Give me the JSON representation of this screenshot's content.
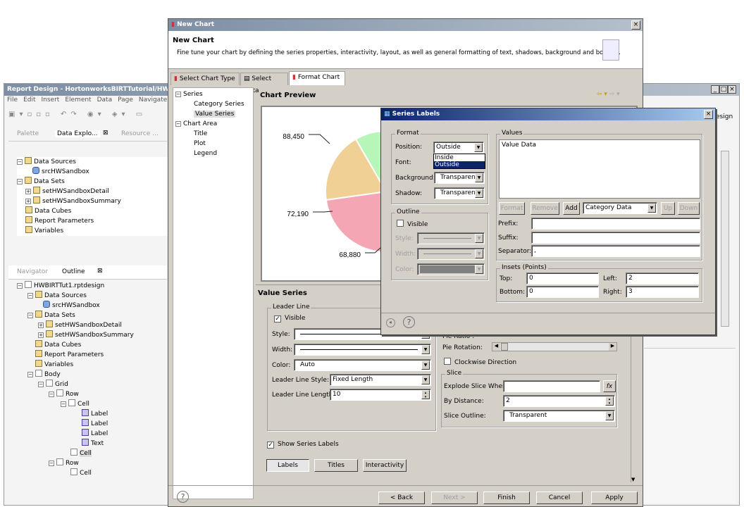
{
  "report_window": {
    "title": "Report Design - HortonworksBIRTTutorial/HW",
    "menu": [
      "File",
      "Edit",
      "Insert",
      "Element",
      "Data",
      "Page",
      "Navigate"
    ],
    "explorer_tabs": [
      "Palette",
      "Data Explo...",
      "Resource ..."
    ],
    "data_tree": [
      "Data Sources",
      "srcHWSandbox",
      "Data Sets",
      "setHWSandboxDetail",
      "setHWSandboxSummary",
      "Data Cubes",
      "Report Parameters",
      "Variables"
    ],
    "outline_tabs": [
      "Navigator",
      "Outline"
    ],
    "outline_tree": [
      "HWBIRTTut1.rptdesign",
      "Data Sources",
      "srcHWSandbox",
      "Data Sets",
      "setHWSandboxDetail",
      "setHWSandboxSummary",
      "Data Cubes",
      "Report Parameters",
      "Variables",
      "Body",
      "Grid",
      "Row",
      "Cell",
      "Label",
      "Label",
      "Label",
      "Text",
      "Cell",
      "Row",
      "Cell"
    ],
    "right_tab_fragment": "esign"
  },
  "new_chart": {
    "window_title": "New Chart",
    "heading": "New Chart",
    "description": "Fine tune your chart by defining the series properties, interactivity, layout, as well as general formatting of text, shadows, background and borders.",
    "tabs": [
      "Select Chart Type",
      "Select Data",
      "Format Chart"
    ],
    "active_tab": "Format Chart",
    "nav_tree": [
      "Series",
      "Category Series",
      "Value Series",
      "Chart Area",
      "Title",
      "Plot",
      "Legend"
    ],
    "selected_nav": "Value Series",
    "preview_title": "Chart Preview",
    "section_title": "Value Series",
    "leader_line": {
      "group": "Leader Line",
      "visible_label": "Visible",
      "visible": true,
      "style_label": "Style:",
      "width_label": "Width:",
      "color_label": "Color:",
      "color_value": "Auto",
      "line_style_label": "Leader Line Style:",
      "line_style_value": "Fixed Length",
      "length_label": "Leader Line Length:",
      "length_value": "10"
    },
    "pie": {
      "ratio_label": "Pie Ratio :",
      "rotation_label": "Pie Rotation:",
      "clockwise_label": "Clockwise Direction",
      "clockwise": false,
      "slice_group": "Slice",
      "explode_label": "Explode Slice When:",
      "explode_value": "",
      "fx": "fx",
      "distance_label": "By Distance:",
      "distance_value": "2",
      "outline_label": "Slice Outline:",
      "outline_value": "Transparent"
    },
    "show_series_labels": "Show Series Labels",
    "show_series_labels_checked": true,
    "sub_buttons": [
      "Labels",
      "Titles",
      "Interactivity"
    ],
    "footer_buttons": {
      "back": "< Back",
      "next": "Next >",
      "finish": "Finish",
      "cancel": "Cancel",
      "apply": "Apply"
    }
  },
  "chart_data": {
    "type": "pie",
    "values": [
      88450,
      72190,
      68880
    ],
    "labels": [
      "88,450",
      "72,190",
      "68,880"
    ],
    "colors": [
      "#f4a6b4",
      "#f1d096",
      "#b8f5b8"
    ]
  },
  "series_labels": {
    "title": "Series Labels",
    "format_group": "Format",
    "position_label": "Position:",
    "position_value": "Outside",
    "position_options": [
      "Inside",
      "Outside"
    ],
    "position_highlighted": "Outside",
    "font_label": "Font:",
    "background_label": "Background:",
    "background_value": "Transparent",
    "shadow_label": "Shadow:",
    "shadow_value": "Transparent",
    "outline_group": "Outline",
    "outline_visible_label": "Visible",
    "outline_visible": false,
    "outline_style_label": "Style:",
    "outline_width_label": "Width:",
    "outline_color_label": "Color:",
    "values_group": "Values",
    "values_list": [
      "Value Data"
    ],
    "buttons": {
      "format": "Format",
      "remove": "Remove",
      "add": "Add",
      "up": "Up",
      "down": "Down"
    },
    "add_select": "Category Data",
    "prefix_label": "Prefix:",
    "prefix_value": "",
    "suffix_label": "Suffix:",
    "suffix_value": "",
    "separator_label": "Separator:",
    "separator_value": ",",
    "insets_group": "Insets (Points)",
    "top_label": "Top:",
    "top_value": "0",
    "bottom_label": "Bottom:",
    "bottom_value": "0",
    "left_label": "Left:",
    "left_value": "2",
    "right_label": "Right:",
    "right_value": "3"
  }
}
